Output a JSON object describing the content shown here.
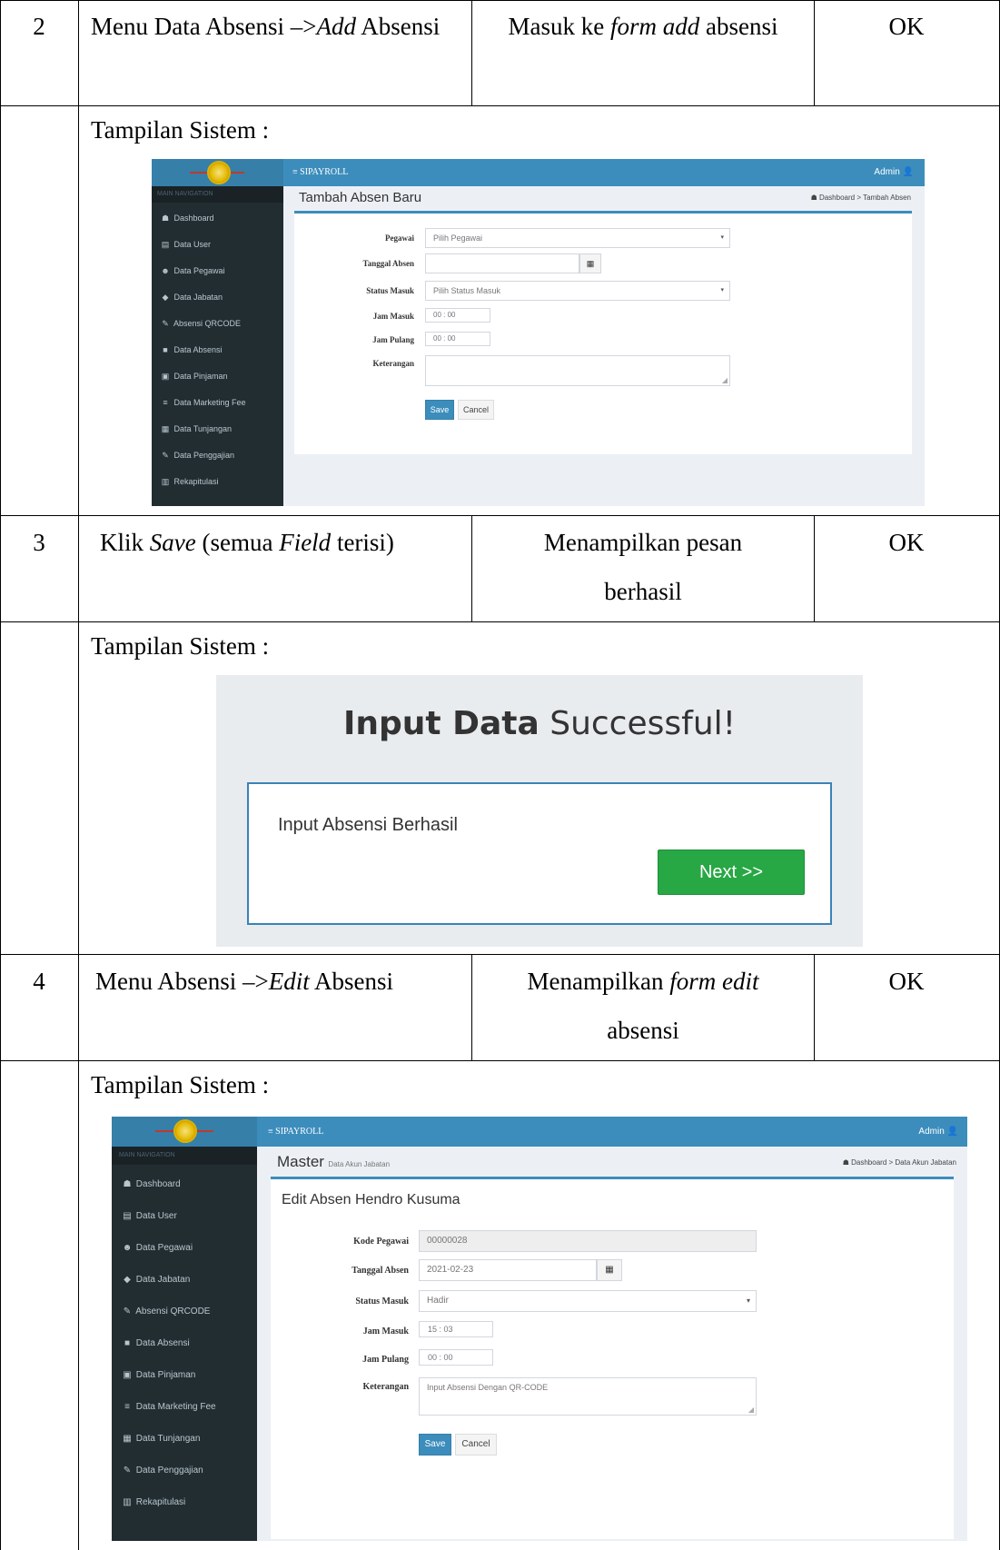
{
  "rows": [
    {
      "no": "2",
      "action_prefix": "Menu Data Absensi –>",
      "action_em": "Add",
      "action_suffix": " Absensi",
      "expected_prefix": "Masuk ke ",
      "expected_em": "form add",
      "expected_suffix": " absensi",
      "result": "OK"
    },
    {
      "no": "3",
      "action_prefix": "Klik ",
      "action_em": "Save",
      "action_mid": " (semua ",
      "action_em2": "Field",
      "action_suffix": " terisi)",
      "expected_prefix": "Menampilkan pesan berhasil",
      "result": "OK"
    },
    {
      "no": "4",
      "action_prefix": "Menu Absensi –>",
      "action_em": "Edit",
      "action_suffix": " Absensi",
      "expected_prefix": "Menampilkan ",
      "expected_em": "form edit",
      "expected_suffix": " absensi",
      "result": "OK"
    }
  ],
  "tampilan_label": "Tampilan Sistem :",
  "shot1": {
    "brand": "≡  SIPAYROLL",
    "admin": "Admin 👤",
    "nav_header": "MAIN NAVIGATION",
    "nav": [
      {
        "icon": "☗",
        "label": "Dashboard"
      },
      {
        "icon": "▤",
        "label": "Data User"
      },
      {
        "icon": "☻",
        "label": "Data Pegawai"
      },
      {
        "icon": "◆",
        "label": "Data Jabatan"
      },
      {
        "icon": "✎",
        "label": "Absensi QRCODE"
      },
      {
        "icon": "■",
        "label": "Data Absensi"
      },
      {
        "icon": "▣",
        "label": "Data Pinjaman"
      },
      {
        "icon": "≡",
        "label": "Data Marketing Fee"
      },
      {
        "icon": "▦",
        "label": "Data Tunjangan"
      },
      {
        "icon": "✎",
        "label": "Data Penggajian"
      },
      {
        "icon": "▥",
        "label": "Rekapitulasi"
      }
    ],
    "title": "Tambah Absen Baru",
    "crumb": "☗ Dashboard  >  Tambah Absen",
    "labels": {
      "pegawai": "Pegawai",
      "tanggal": "Tanggal Absen",
      "status": "Status Masuk",
      "jam_masuk": "Jam Masuk",
      "jam_pulang": "Jam Pulang",
      "ket": "Keterangan"
    },
    "values": {
      "pegawai": "Pilih Pegawai",
      "tanggal": "",
      "status": "Pilih Status Masuk",
      "jam_masuk": "00  :  00",
      "jam_pulang": "00  :  00",
      "ket": ""
    },
    "save": "Save",
    "cancel": "Cancel"
  },
  "success": {
    "title_bold": "Input Data",
    "title_rest": " Successful!",
    "message": "Input Absensi Berhasil",
    "next": "Next >>"
  },
  "shot2": {
    "brand": "≡  SIPAYROLL",
    "admin": "Admin 👤",
    "nav_header": "MAIN NAVIGATION",
    "nav": [
      {
        "icon": "☗",
        "label": "Dashboard"
      },
      {
        "icon": "▤",
        "label": "Data User"
      },
      {
        "icon": "☻",
        "label": "Data Pegawai"
      },
      {
        "icon": "◆",
        "label": "Data Jabatan"
      },
      {
        "icon": "✎",
        "label": "Absensi QRCODE"
      },
      {
        "icon": "■",
        "label": "Data Absensi"
      },
      {
        "icon": "▣",
        "label": "Data Pinjaman"
      },
      {
        "icon": "≡",
        "label": "Data Marketing Fee"
      },
      {
        "icon": "▦",
        "label": "Data Tunjangan"
      },
      {
        "icon": "✎",
        "label": "Data Penggajian"
      },
      {
        "icon": "▥",
        "label": "Rekapitulasi"
      }
    ],
    "page_title": "Master",
    "page_sub": "Data Akun Jabatan",
    "crumb": "☗ Dashboard  >  Data Akun Jabatan",
    "title": "Edit Absen Hendro Kusuma",
    "labels": {
      "kode": "Kode Pegawai",
      "tanggal": "Tanggal Absen",
      "status": "Status Masuk",
      "jam_masuk": "Jam Masuk",
      "jam_pulang": "Jam Pulang",
      "ket": "Keterangan"
    },
    "values": {
      "kode": "00000028",
      "tanggal": "2021-02-23",
      "status": "Hadir",
      "jam_masuk": "15  :  03",
      "jam_pulang": "00  :  00",
      "ket": "Input Absensi Dengan QR-CODE"
    },
    "save": "Save",
    "cancel": "Cancel"
  }
}
